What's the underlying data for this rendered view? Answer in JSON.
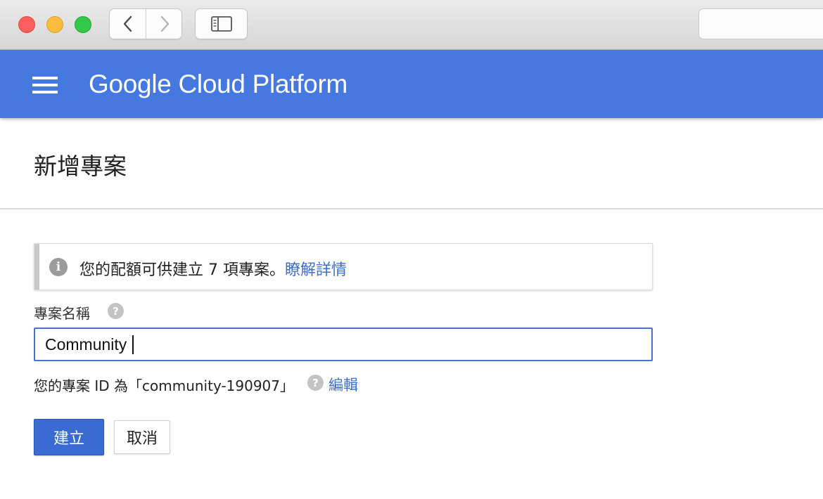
{
  "browser": {
    "back_icon": "chevron-left-icon",
    "forward_icon": "chevron-right-icon",
    "sidebar_icon": "sidebar-toggle-icon"
  },
  "header": {
    "menu_icon": "hamburger-menu-icon",
    "brand": "Google Cloud Platform",
    "color": "#4679e0"
  },
  "page": {
    "title": "新增專案"
  },
  "info": {
    "icon": "info-icon",
    "text": "您的配額可供建立 7 項專案。",
    "link": "瞭解詳情"
  },
  "form": {
    "name_label": "專案名稱",
    "name_value": "Community",
    "help_icon": "help-icon",
    "project_id_text": "您的專案 ID 為「community-190907」",
    "edit_link": "編輯"
  },
  "actions": {
    "create_label": "建立",
    "cancel_label": "取消",
    "primary_color": "#3a6bd3",
    "link_color": "#3b6fd6"
  }
}
